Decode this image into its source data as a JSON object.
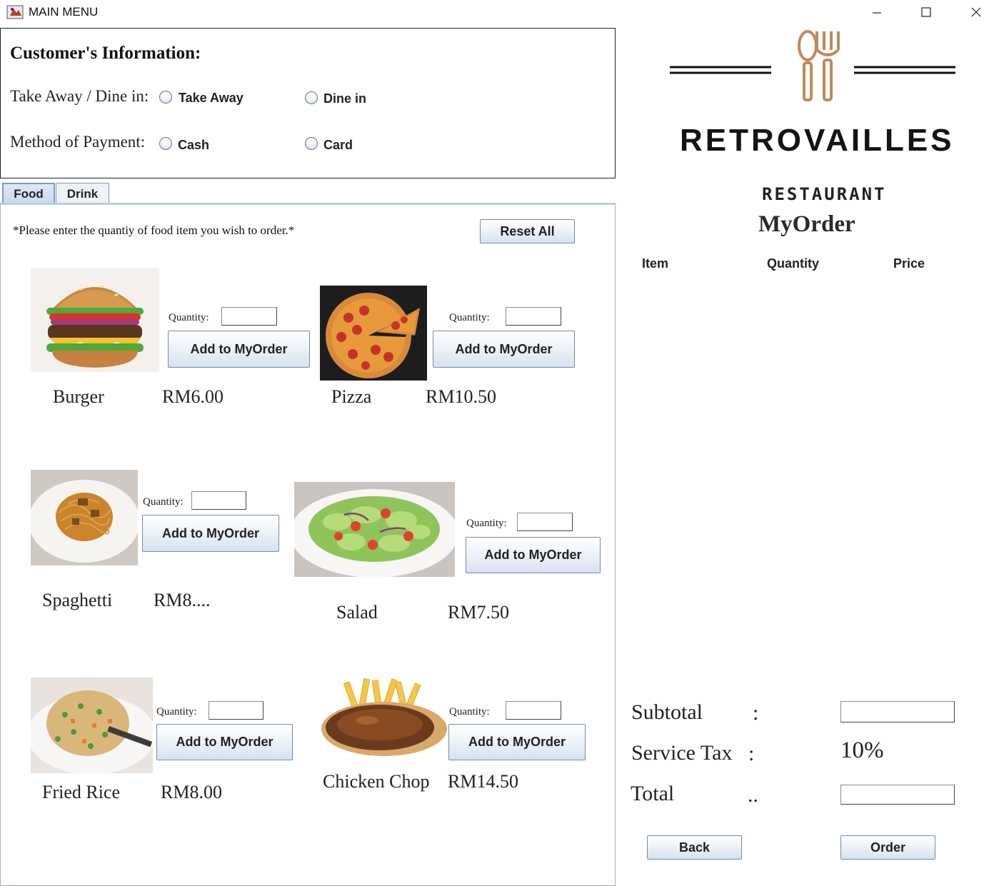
{
  "window": {
    "title": "MAIN MENU"
  },
  "customer_info": {
    "heading": "Customer's Information:",
    "order_type_label": "Take Away / Dine in:",
    "order_type_options": [
      "Take Away",
      "Dine in"
    ],
    "payment_label": "Method of Payment:",
    "payment_options": [
      "Cash",
      "Card"
    ]
  },
  "tabs": [
    {
      "label": "Food",
      "active": true
    },
    {
      "label": "Drink",
      "active": false
    }
  ],
  "food": {
    "instruction": "*Please enter the quantiy of food item you wish to order.*",
    "reset_label": "Reset All",
    "quantity_label": "Quantity:",
    "add_label": "Add to MyOrder",
    "items": [
      {
        "name": "Burger",
        "price": "RM6.00",
        "icon": "burger-image"
      },
      {
        "name": "Pizza",
        "price": "RM10.50",
        "icon": "pizza-image"
      },
      {
        "name": "Spaghetti",
        "price": "RM8....",
        "icon": "spaghetti-image"
      },
      {
        "name": "Salad",
        "price": "RM7.50",
        "icon": "salad-image"
      },
      {
        "name": "Fried Rice",
        "price": "RM8.00",
        "icon": "fried-rice-image"
      },
      {
        "name": "Chicken Chop",
        "price": "RM14.50",
        "icon": "chicken-chop-image"
      }
    ]
  },
  "brand": {
    "name": "RETROVAILLES",
    "subtitle": "RESTAURANT",
    "logo_color": "#c08a5a"
  },
  "order": {
    "title": "MyOrder",
    "columns": [
      "Item",
      "Quantity",
      "Price"
    ],
    "subtotal_label": "Subtotal",
    "subtotal_sep": ":",
    "tax_label": "Service Tax",
    "tax_sep": ":",
    "tax_value": "10%",
    "total_label": "Total",
    "total_sep": "..",
    "back_label": "Back",
    "order_label": "Order"
  }
}
